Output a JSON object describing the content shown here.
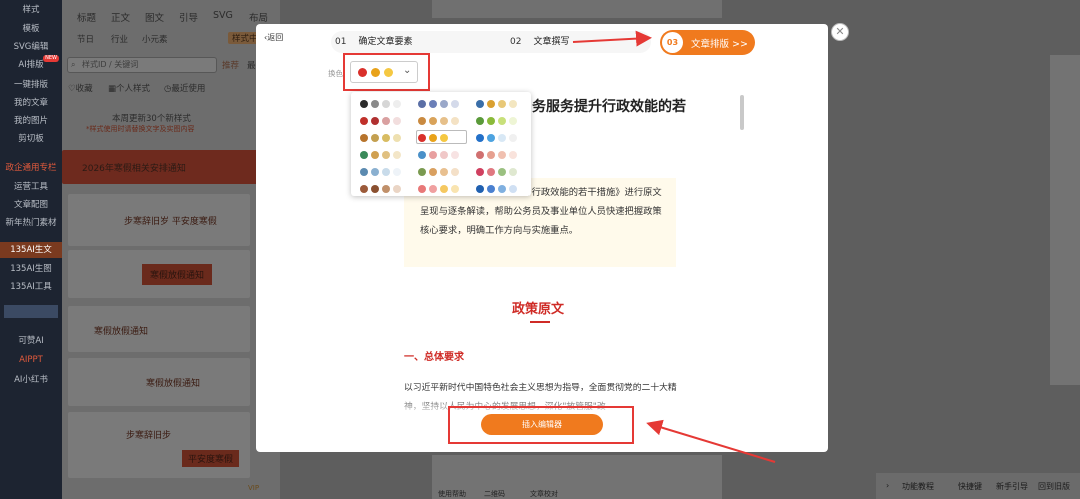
{
  "sidebar": {
    "items": [
      "样式",
      "模板",
      "SVG编辑",
      "AI排版",
      "一键排版",
      "我的文章",
      "我的图片",
      "剪切板",
      "政企通用专栏",
      "运营工具",
      "文章配图",
      "新年热门素材",
      "135AI生文",
      "135AI生图",
      "135AI工具",
      "",
      "可赞AI",
      "AIPPT",
      "AI小红书"
    ],
    "new_badge": "NEW"
  },
  "template_panel": {
    "tabs": [
      "标题",
      "正文",
      "图文",
      "引导",
      "SVG",
      "布局"
    ],
    "tabs2": [
      "节日",
      "行业",
      "小元素"
    ],
    "style_center": "样式中",
    "search_placeholder": "样式ID / 关键词",
    "filters": [
      "推荐",
      "最新"
    ],
    "favorites": "收藏",
    "personal_styles": "个人样式",
    "recent": "最近使用",
    "notice": "本周更新30个新样式",
    "notice_red": "*样式使用时请替换文字及实图内容",
    "cards": [
      "2026年寒假相关安排通知",
      "步寒辞旧岁 平安度寒假",
      "寒假放假通知",
      "寒假放假通知",
      "寒假放假通知",
      "步寒辞旧步",
      "平安度寒假"
    ],
    "vip": "VIP"
  },
  "modal": {
    "back": "返回",
    "steps": [
      {
        "num": "01",
        "label": "确定文章要素"
      },
      {
        "num": "02",
        "label": "文章撰写"
      },
      {
        "num": "03",
        "label": "文章排版"
      }
    ],
    "step3_suffix": ">>",
    "palette_label": "换色",
    "selected_colors": [
      "#d9302b",
      "#e8a21a",
      "#f5c842"
    ],
    "title_visible": "务服务提升行政效能的若",
    "intro_visible": "干进一步优化政务服务提升行政效能的若干措施》进行原文呈现与逐条解读，帮助公务员及事业单位人员快速把握政策核心要求，明确工作方向与实施重点。",
    "section_title": "政策原文",
    "subheading": "一、总体要求",
    "paragraph": "以习近平新时代中国特色社会主义思想为指导，全面贯彻党的二十大精神，坚持以人民为中心的发展思想，深化\"放管服\"改",
    "insert_button": "插入编辑器"
  },
  "palettes": [
    [
      "#2b2b2b",
      "#8a8a8a",
      "#d6d6d6",
      "#eeeeee"
    ],
    [
      "#5b6fa6",
      "#6b7fb8",
      "#9aa8c9",
      "#d4daea"
    ],
    [
      "#3a6ea8",
      "#d9a030",
      "#e8c878",
      "#f3e6c0"
    ],
    [
      "#c0302a",
      "#b03030",
      "#d9a0a0",
      "#f2dede"
    ],
    [
      "#c98a40",
      "#d9a35a",
      "#e6c08a",
      "#f4e2c4"
    ],
    [
      "#5a9a3a",
      "#8aba3a",
      "#c8e07a",
      "#eef5d5"
    ],
    [
      "#b7742c",
      "#c4a050",
      "#d8bc62",
      "#eee0b0"
    ],
    [
      "#d9302b",
      "#e8a21a",
      "#f5c842",
      "#ffffff"
    ],
    [
      "#2370c8",
      "#4da3e0",
      "#d8e8f5",
      "#f0f0f0"
    ],
    [
      "#3a8a5a",
      "#d0a050",
      "#e0c080",
      "#f3e6c8"
    ],
    [
      "#4a90c8",
      "#e8a0a0",
      "#f0c8c8",
      "#f7e3e3"
    ],
    [
      "#d07070",
      "#e6a090",
      "#f0c0b0",
      "#f9e3dc"
    ],
    [
      "#5b8ab0",
      "#8ab0d0",
      "#c8dbea",
      "#eef3f8"
    ],
    [
      "#7a9a50",
      "#d9a060",
      "#e8c090",
      "#f4e0c8"
    ],
    [
      "#d04060",
      "#e07880",
      "#9ac080",
      "#dfe8d0"
    ],
    [
      "#9b5a3a",
      "#8a5030",
      "#c0906a",
      "#ead5c5"
    ],
    [
      "#e87878",
      "#f0a0a0",
      "#f5c860",
      "#f9e4b0"
    ],
    [
      "#2060b0",
      "#4a80d0",
      "#80b0e0",
      "#d0e0f3"
    ]
  ],
  "editor": {
    "bottom_left": [
      "使用帮助",
      "二维码",
      "文章校对"
    ],
    "bottom_right": [
      "功能教程",
      "快捷键",
      "新手引导",
      "回到旧版"
    ]
  }
}
